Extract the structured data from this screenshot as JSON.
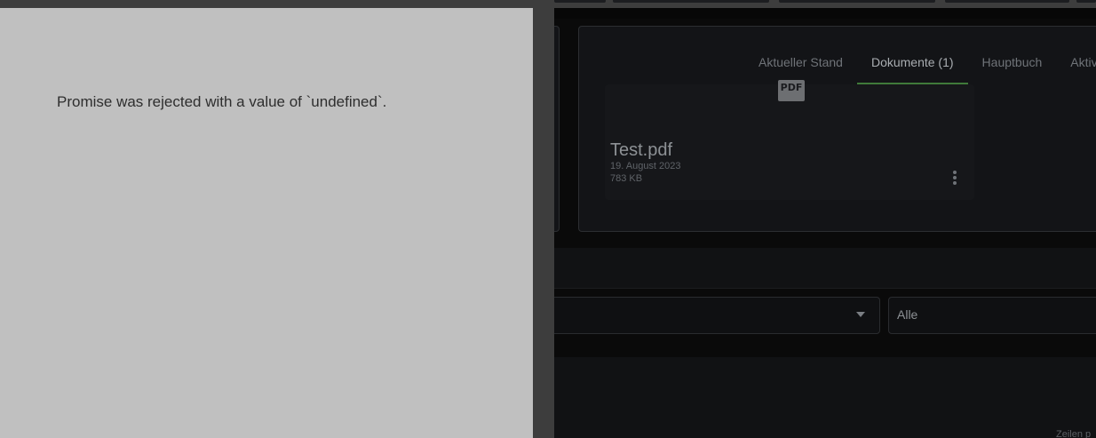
{
  "error": {
    "message": "Promise was rejected with a value of `undefined`."
  },
  "tabs": [
    {
      "label": "Aktueller Stand"
    },
    {
      "label": "Dokumente (1)"
    },
    {
      "label": "Hauptbuch"
    },
    {
      "label": "Aktiv"
    }
  ],
  "active_tab": 1,
  "document": {
    "icon_label": "PDF",
    "name": "Test.pdf",
    "date": "19. August 2023",
    "size": "783 KB"
  },
  "filter": {
    "value": "Alle"
  },
  "footer": {
    "text": "Zeilen p"
  }
}
